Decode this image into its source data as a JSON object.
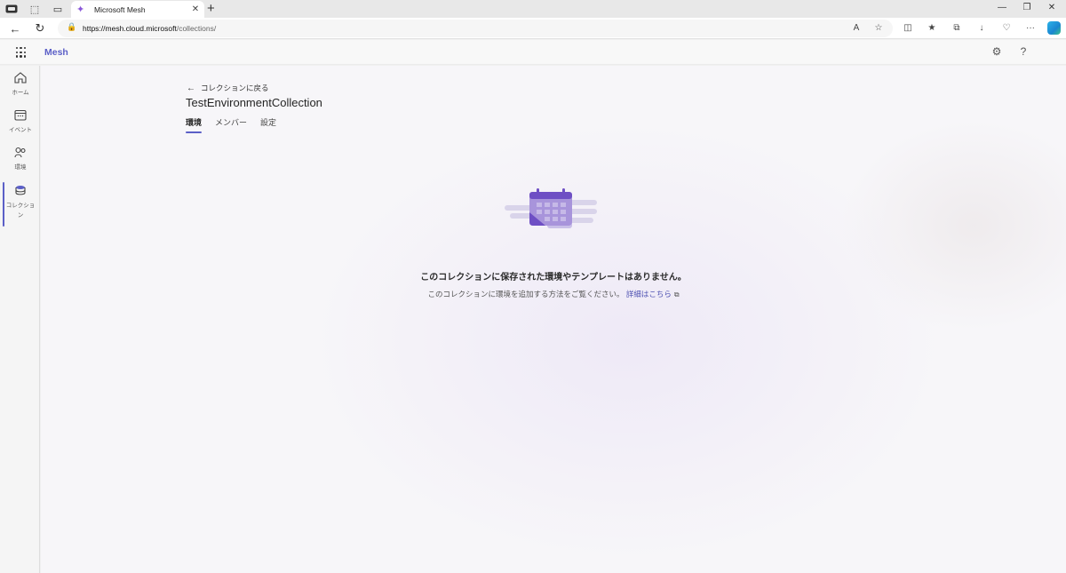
{
  "browser": {
    "tab_title": "Microsoft Mesh",
    "url_host": "https://mesh.cloud.microsoft",
    "url_path": "/collections/",
    "new_tab": "+",
    "close": "✕"
  },
  "app": {
    "brand": "Mesh"
  },
  "rail": {
    "items": [
      {
        "label": "ホーム",
        "icon": "home-icon"
      },
      {
        "label": "イベント",
        "icon": "calendar-icon"
      },
      {
        "label": "環境",
        "icon": "environment-icon"
      },
      {
        "label": "コレクション",
        "icon": "collection-icon"
      }
    ]
  },
  "page": {
    "back_label": "コレクションに戻る",
    "title": "TestEnvironmentCollection",
    "tabs": [
      {
        "label": "環境",
        "active": true
      },
      {
        "label": "メンバー",
        "active": false
      },
      {
        "label": "設定",
        "active": false
      }
    ]
  },
  "empty_state": {
    "title": "このコレクションに保存された環境やテンプレートはありません。",
    "subtitle": "このコレクションに環境を追加する方法をご覧ください。",
    "link": "詳細はこちら"
  },
  "colors": {
    "accent": "#5b5fc7",
    "link": "#4f52b2"
  }
}
